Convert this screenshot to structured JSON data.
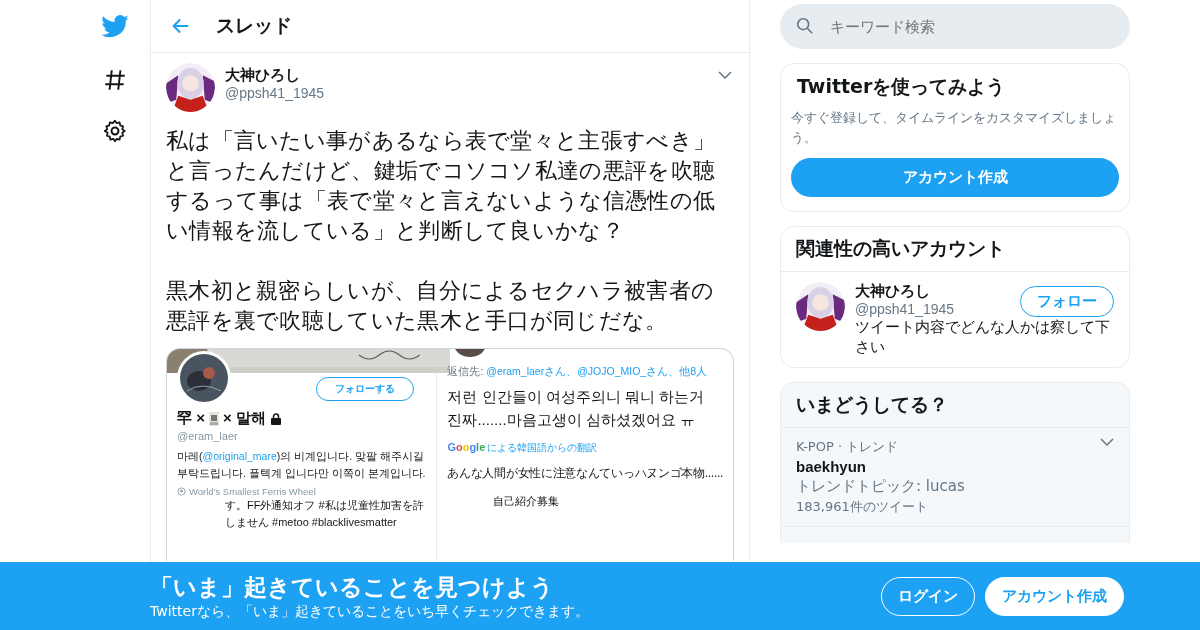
{
  "header": {
    "title": "スレッド"
  },
  "tweet": {
    "name": "大神ひろし",
    "handle": "@ppsh41_1945",
    "paragraphs": [
      "私は「言いたい事があるなら表で堂々と主張すべき」と言ったんだけど、鍵垢でコソコソ私達の悪評を吹聴するって事は「表で堂々と言えないような信憑性の低い情報を流している」と判断して良いかな？",
      "黒木初と親密らしいが、自分によるセクハラ被害者の悪評を裏で吹聴していた黒木と手口が同じだな。"
    ],
    "image": {
      "left": {
        "follow": "フォローする",
        "name_left": "罕 ×",
        "name_right": "× 말해",
        "handle": "@eram_laer",
        "bio_before": "마레(",
        "bio_link": "@original_mare",
        "bio_after": ")의 비계입니다. 맞팔 해주시길 부탁드립니다. 플텍계 입니다만 이쪽이 본계입니다.",
        "location": "World's Smallest Ferris Wheel",
        "overlay": "す。FF外通知オフ #私は児童性加害を許しません #metoo #blacklivesmatter"
      },
      "right": {
        "reply_label": "返信先:",
        "reply_to": "@eram_laerさん、@JOJO_MIO_さん、他8人",
        "text": "저런 인간들이 여성주의니 뭐니 하는거 진짜.......마음고생이 심하셨겠어요 ㅠ",
        "google": "Google",
        "translate": "による韓国語からの翻訳",
        "translation": "あんな人間が女性に注意なんていっハヌンゴ本物......",
        "bio": "自己紹介募集"
      }
    }
  },
  "search": {
    "placeholder": "キーワード検索"
  },
  "signup_card": {
    "title": "Twitterを使ってみよう",
    "text": "今すぐ登録して、タイムラインをカスタマイズしましょう。",
    "button": "アカウント作成"
  },
  "related": {
    "title": "関連性の高いアカウント",
    "accounts": [
      {
        "name": "大神ひろし",
        "handle": "@ppsh41_1945",
        "bio": "ツイート内容でどんな人かは察して下さい",
        "button": "フォロー"
      }
    ]
  },
  "trends": {
    "title": "いまどうしてる？",
    "items": [
      {
        "context": "K-POP · トレンド",
        "name": "baekhyun",
        "topic": "トレンドトピック: lucas",
        "count": "183,961件のツイート"
      }
    ]
  },
  "banner": {
    "title": "「いま」起きていることを見つけよう",
    "subtitle": "Twitterなら、「いま」起きていることをいち早くチェックできます。",
    "login": "ログイン",
    "signup": "アカウント作成"
  }
}
